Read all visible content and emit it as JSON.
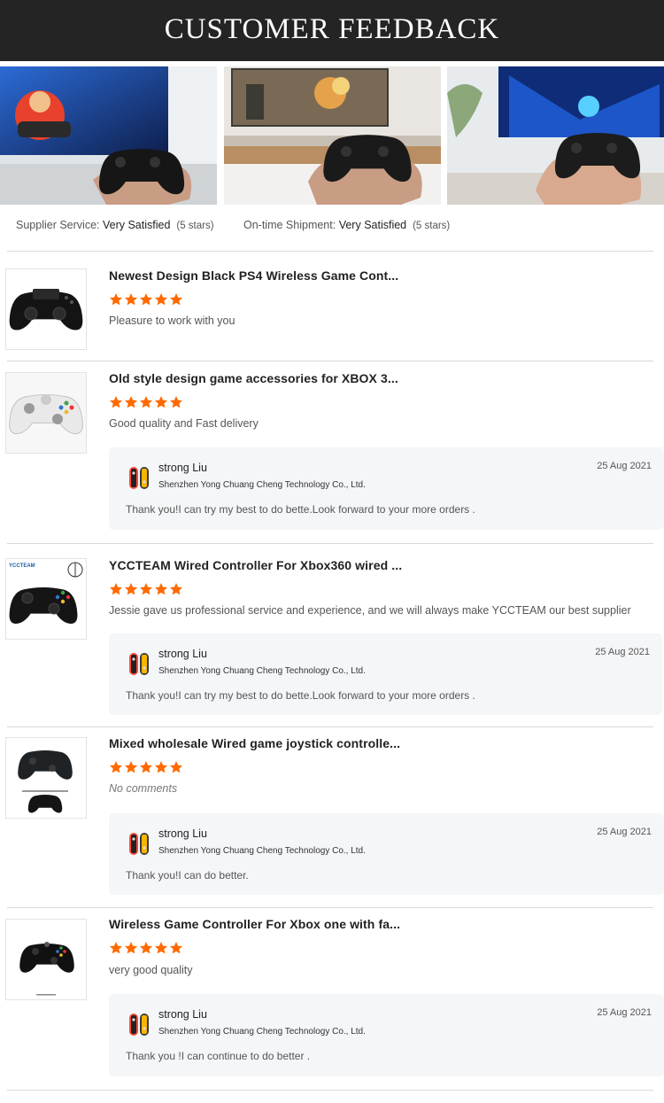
{
  "header": {
    "title": "CUSTOMER FEEDBACK"
  },
  "photos": [
    "racing-game-controller-photo",
    "shooter-game-controller-photo",
    "console-game-controller-photo"
  ],
  "summary": {
    "supplier_label": "Supplier Service:",
    "supplier_value": "Very Satisfied",
    "supplier_stars": "(5 stars)",
    "shipment_label": "On-time Shipment:",
    "shipment_value": "Very Satisfied",
    "shipment_stars": "(5 stars)"
  },
  "star_color": "#ff6a00",
  "reviews": [
    {
      "title": "Newest Design Black PS4 Wireless Game Cont...",
      "rating": 5,
      "comment": "Pleasure to work with you",
      "product": "black-ps4-controller"
    },
    {
      "title": "Old style design game accessories for XBOX 3...",
      "rating": 5,
      "comment": "Good quality and Fast delivery",
      "product": "white-xbox360-controller",
      "reply": {
        "name": "strong Liu",
        "company": "Shenzhen Yong Chuang Cheng Technology Co., Ltd.",
        "date": "25 Aug 2021",
        "text": "Thank you!I can try my best to do bette.Look forward to your more orders ."
      }
    },
    {
      "title": "YCCTEAM Wired Controller For Xbox360 wired ...",
      "rating": 5,
      "comment": "Jessie gave us professional service and experience, and we will always make YCCTEAM our best supplier",
      "product": "black-wired-xbox360-controller",
      "thumb_brand": "YCCTEAM",
      "reply": {
        "name": "strong Liu",
        "company": "Shenzhen Yong Chuang Cheng Technology Co., Ltd.",
        "date": "25 Aug 2021",
        "text": "Thank you!I can try my best to do bette.Look forward to your more orders ."
      }
    },
    {
      "title": "Mixed wholesale Wired game joystick controlle...",
      "rating": 5,
      "comment": "No comments",
      "product": "two-wired-controllers",
      "reply": {
        "name": "strong Liu",
        "company": "Shenzhen Yong Chuang Cheng Technology Co., Ltd.",
        "date": "25 Aug 2021",
        "text": "Thank you!I can do better."
      }
    },
    {
      "title": "Wireless Game Controller For Xbox one with fa...",
      "rating": 5,
      "comment": "very good quality",
      "product": "black-xbox-one-controller",
      "reply": {
        "name": "strong Liu",
        "company": "Shenzhen Yong Chuang Cheng Technology Co., Ltd.",
        "date": "25 Aug 2021",
        "text": "Thank you !I can continue to do better ."
      }
    }
  ]
}
